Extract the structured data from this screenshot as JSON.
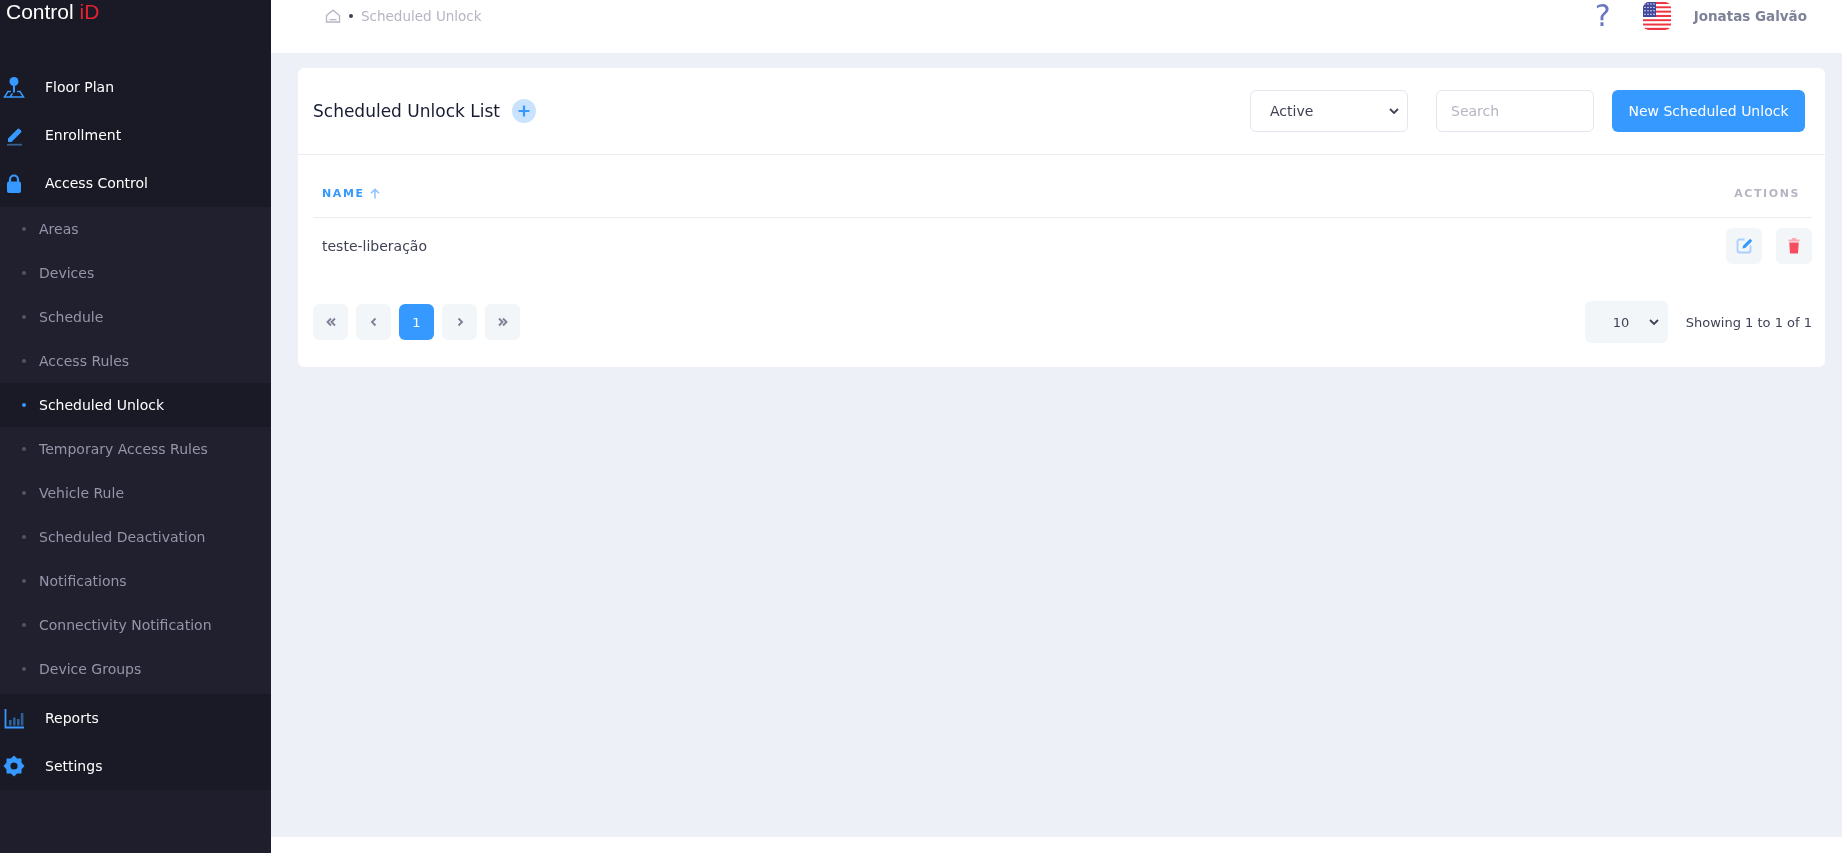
{
  "logo": {
    "text": "Control",
    "accent": "iD"
  },
  "sidebar": {
    "items": [
      {
        "label": "Floor Plan"
      },
      {
        "label": "Enrollment"
      },
      {
        "label": "Access Control",
        "expanded": true,
        "children": [
          {
            "label": "Areas",
            "selected": false
          },
          {
            "label": "Devices",
            "selected": false
          },
          {
            "label": "Schedule",
            "selected": false
          },
          {
            "label": "Access Rules",
            "selected": false
          },
          {
            "label": "Scheduled Unlock",
            "selected": true
          },
          {
            "label": "Temporary Access Rules",
            "selected": false
          },
          {
            "label": "Vehicle Rule",
            "selected": false
          },
          {
            "label": "Scheduled Deactivation",
            "selected": false
          },
          {
            "label": "Notifications",
            "selected": false
          },
          {
            "label": "Connectivity Notification",
            "selected": false
          },
          {
            "label": "Device Groups",
            "selected": false
          }
        ]
      },
      {
        "label": "Reports"
      },
      {
        "label": "Settings"
      }
    ]
  },
  "topbar": {
    "breadcrumb": [
      "Scheduled Unlock"
    ],
    "help": "?",
    "user_name": "Jonatas Galvão"
  },
  "card": {
    "title": "Scheduled Unlock List",
    "status_filter": {
      "value": "Active"
    },
    "search": {
      "placeholder": "Search"
    },
    "new_button": "New Scheduled Unlock",
    "table": {
      "columns": [
        {
          "label": "NAME",
          "sorted": true
        },
        {
          "label": "ACTIONS",
          "sorted": false
        }
      ],
      "rows": [
        {
          "name": "teste-liberação"
        }
      ]
    },
    "pagination": {
      "pages": [
        {
          "label": "1",
          "selected": true
        }
      ],
      "page_size": "10",
      "summary": "Showing 1 to 1 of 1"
    }
  }
}
